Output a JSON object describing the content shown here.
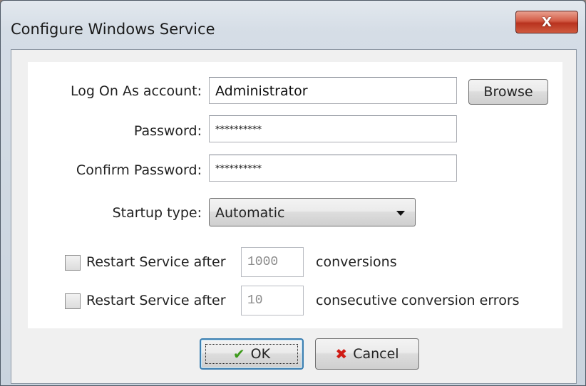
{
  "window": {
    "title": "Configure Windows Service",
    "close_glyph": "X"
  },
  "form": {
    "logon_label": "Log On As account:",
    "logon_value": "Administrator",
    "browse_label": "Browse",
    "password_label": "Password:",
    "password_value": "**********",
    "confirm_label": "Confirm Password:",
    "confirm_value": "**********",
    "startup_label": "Startup type:",
    "startup_value": "Automatic",
    "restart1": {
      "label": "Restart Service after",
      "value": "1000",
      "suffix": "conversions",
      "checked": false
    },
    "restart2": {
      "label": "Restart Service after",
      "value": "10",
      "suffix": "consecutive conversion errors",
      "checked": false
    }
  },
  "footer": {
    "ok_label": "OK",
    "cancel_label": "Cancel"
  },
  "icons": {
    "ok": "check-icon",
    "cancel": "x-icon",
    "close": "close-icon"
  },
  "colors": {
    "close_button": "#c9452f",
    "ok_check": "#3c9a1a",
    "cancel_x": "#d01b14",
    "focus_border": "#3c7fb1"
  }
}
